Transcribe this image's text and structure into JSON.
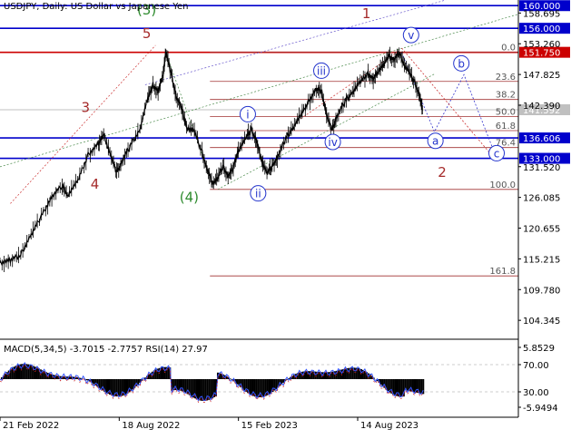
{
  "header": {
    "symbol": "USDJPY",
    "timeframe": "Daily",
    "description": "US Dollar vs Japanese Yen",
    "text": "USDJPY, Daily:  US Dollar vs Japanese Yen"
  },
  "macd_header": {
    "text": "MACD(5,34,5) -3.7015 -2.7757 RSI(14) 27.97"
  },
  "chart_data": [
    {
      "type": "candlestick-line",
      "y_axis_ticks": [
        "158.695",
        "153.260",
        "147.825",
        "142.390",
        "131.520",
        "126.085",
        "120.655",
        "115.215",
        "109.780",
        "104.345"
      ],
      "x_axis_ticks": [
        "21 Feb 2022",
        "18 Aug 2022",
        "15 Feb 2023",
        "14 Aug 2023"
      ],
      "ylim": [
        101,
        161
      ],
      "price_path": [
        [
          0.0,
          114.5
        ],
        [
          0.02,
          114.9
        ],
        [
          0.04,
          116.0
        ],
        [
          0.06,
          119.5
        ],
        [
          0.08,
          122.8
        ],
        [
          0.1,
          126.2
        ],
        [
          0.12,
          128.2
        ],
        [
          0.13,
          126.5
        ],
        [
          0.15,
          129.0
        ],
        [
          0.17,
          133.6
        ],
        [
          0.19,
          135.6
        ],
        [
          0.2,
          137.3
        ],
        [
          0.215,
          133.0
        ],
        [
          0.225,
          130.5
        ],
        [
          0.235,
          132.5
        ],
        [
          0.25,
          135.0
        ],
        [
          0.27,
          138.2
        ],
        [
          0.285,
          143.5
        ],
        [
          0.295,
          146.0
        ],
        [
          0.305,
          144.8
        ],
        [
          0.315,
          148.0
        ],
        [
          0.32,
          151.7
        ],
        [
          0.33,
          148.0
        ],
        [
          0.34,
          144.0
        ],
        [
          0.35,
          142.0
        ],
        [
          0.36,
          138.5
        ],
        [
          0.375,
          137.8
        ],
        [
          0.39,
          134.0
        ],
        [
          0.4,
          131.0
        ],
        [
          0.41,
          128.5
        ],
        [
          0.42,
          129.5
        ],
        [
          0.43,
          131.5
        ],
        [
          0.44,
          130.0
        ],
        [
          0.45,
          131.3
        ],
        [
          0.46,
          134.5
        ],
        [
          0.475,
          136.6
        ],
        [
          0.485,
          138.2
        ],
        [
          0.495,
          136.0
        ],
        [
          0.505,
          132.5
        ],
        [
          0.515,
          130.3
        ],
        [
          0.525,
          131.5
        ],
        [
          0.535,
          133.2
        ],
        [
          0.55,
          136.3
        ],
        [
          0.565,
          138.5
        ],
        [
          0.58,
          140.5
        ],
        [
          0.595,
          143.0
        ],
        [
          0.61,
          145.2
        ],
        [
          0.62,
          145.0
        ],
        [
          0.63,
          140.5
        ],
        [
          0.64,
          138.0
        ],
        [
          0.65,
          140.5
        ],
        [
          0.665,
          143.0
        ],
        [
          0.68,
          144.8
        ],
        [
          0.695,
          146.5
        ],
        [
          0.71,
          148.0
        ],
        [
          0.72,
          147.0
        ],
        [
          0.73,
          148.5
        ],
        [
          0.74,
          149.5
        ],
        [
          0.75,
          151.1
        ],
        [
          0.76,
          150.5
        ],
        [
          0.77,
          151.7
        ],
        [
          0.78,
          149.5
        ],
        [
          0.79,
          148.0
        ],
        [
          0.8,
          146.5
        ],
        [
          0.81,
          144.0
        ],
        [
          0.815,
          141.59
        ]
      ],
      "horizontal_levels": [
        {
          "label": "160.000",
          "price": 160.0,
          "color": "#0000cc"
        },
        {
          "label": "156.000",
          "price": 156.0,
          "color": "#0000cc"
        },
        {
          "label": "151.750",
          "price": 151.75,
          "color": "#cc0000"
        },
        {
          "label": "141.592",
          "price": 141.59,
          "color": "#c0c0c0"
        },
        {
          "label": "136.606",
          "price": 136.606,
          "color": "#0000cc"
        },
        {
          "label": "133.000",
          "price": 133.0,
          "color": "#0000cc"
        }
      ],
      "fibonacci": [
        {
          "label": "0.0",
          "price": 151.75
        },
        {
          "label": "23.6",
          "price": 146.6
        },
        {
          "label": "38.2",
          "price": 143.4
        },
        {
          "label": "50.0",
          "price": 140.4
        },
        {
          "label": "61.8",
          "price": 137.9
        },
        {
          "label": "76.4",
          "price": 134.9
        },
        {
          "label": "100.0",
          "price": 127.5
        },
        {
          "label": "161.8",
          "price": 112.2
        }
      ],
      "wave_labels": [
        {
          "text": "(3)",
          "x": 0.283,
          "price": 158.4,
          "color": "#2e8b2e"
        },
        {
          "text": "5",
          "x": 0.283,
          "price": 154.3,
          "color": "#a52a2a"
        },
        {
          "text": "3",
          "x": 0.165,
          "price": 141.2,
          "color": "#a52a2a"
        },
        {
          "text": "4",
          "x": 0.183,
          "price": 127.6,
          "color": "#a52a2a"
        },
        {
          "text": "(4)",
          "x": 0.365,
          "price": 125.3,
          "color": "#2e8b2e"
        },
        {
          "text": "1",
          "x": 0.707,
          "price": 157.8,
          "color": "#a52a2a"
        },
        {
          "text": "2",
          "x": 0.853,
          "price": 129.7,
          "color": "#a52a2a"
        }
      ],
      "circled_labels": [
        "i",
        "ii",
        "iii",
        "iv",
        "v",
        "a",
        "b",
        "c"
      ]
    },
    {
      "type": "oscillator",
      "title": "MACD(5,34,5) RSI(14)",
      "y_axis_ticks": [
        "5.8529",
        "70.00",
        "30.00",
        "-5.9494"
      ],
      "values": [
        -3.7015,
        -2.7757,
        27.97
      ]
    }
  ]
}
